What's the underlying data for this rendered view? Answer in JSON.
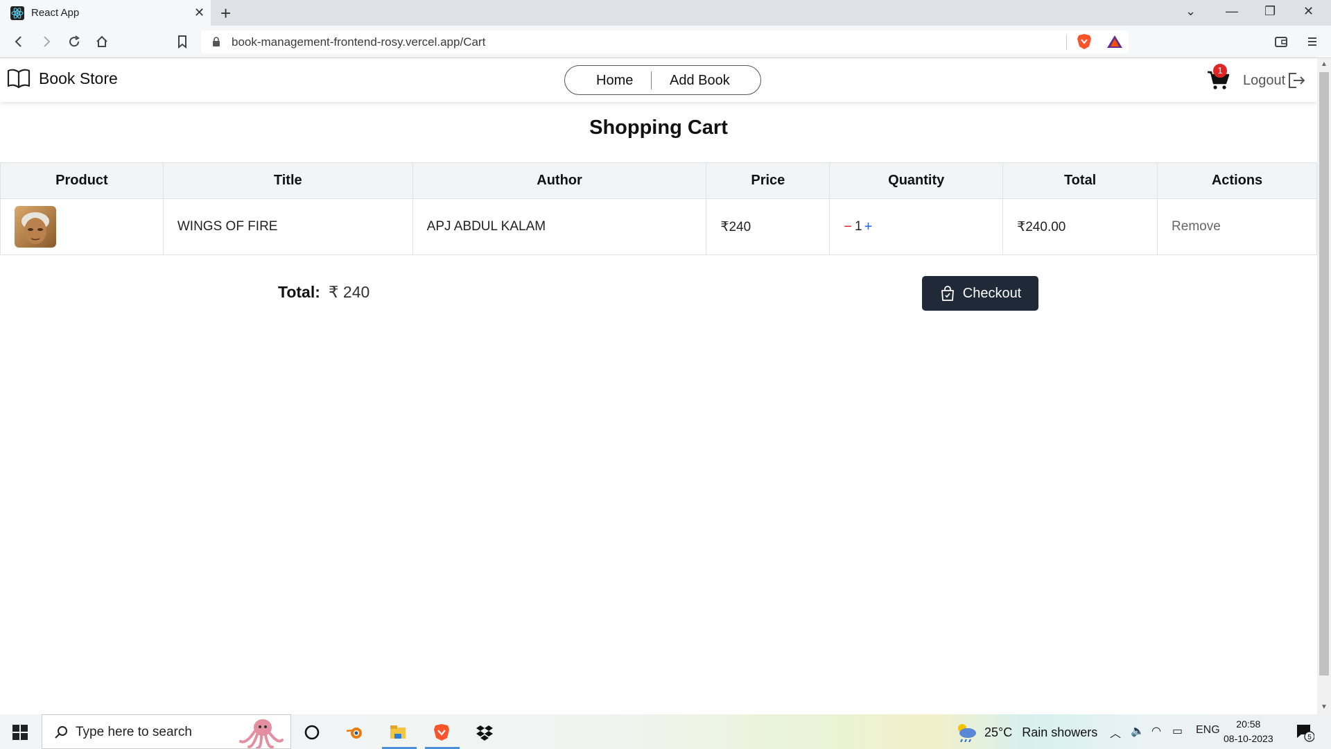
{
  "browser": {
    "tab_title": "React App",
    "url": "book-management-frontend-rosy.vercel.app/Cart"
  },
  "header": {
    "brand": "Book Store",
    "nav": {
      "home": "Home",
      "add_book": "Add Book"
    },
    "cart_count": "1",
    "logout": "Logout"
  },
  "cart": {
    "title": "Shopping Cart",
    "columns": [
      "Product",
      "Title",
      "Author",
      "Price",
      "Quantity",
      "Total",
      "Actions"
    ],
    "rows": [
      {
        "title": "WINGS OF FIRE",
        "author": "APJ ABDUL KALAM",
        "price": "₹240",
        "qty_minus": "−",
        "quantity": "1",
        "qty_plus": "+",
        "total": "₹240.00",
        "action": "Remove"
      }
    ],
    "total_label": "Total:",
    "total_value": "₹ 240",
    "checkout_label": "Checkout"
  },
  "taskbar": {
    "search_placeholder": "Type here to search",
    "weather_temp": "25°C",
    "weather_cond": "Rain showers",
    "lang": "ENG",
    "time": "20:58",
    "date": "08-10-2023",
    "notif_count": "5"
  },
  "colors": {
    "checkout_bg": "#1f2937",
    "badge": "#e02424",
    "qty_minus": "#e02424",
    "qty_plus": "#2563eb"
  }
}
